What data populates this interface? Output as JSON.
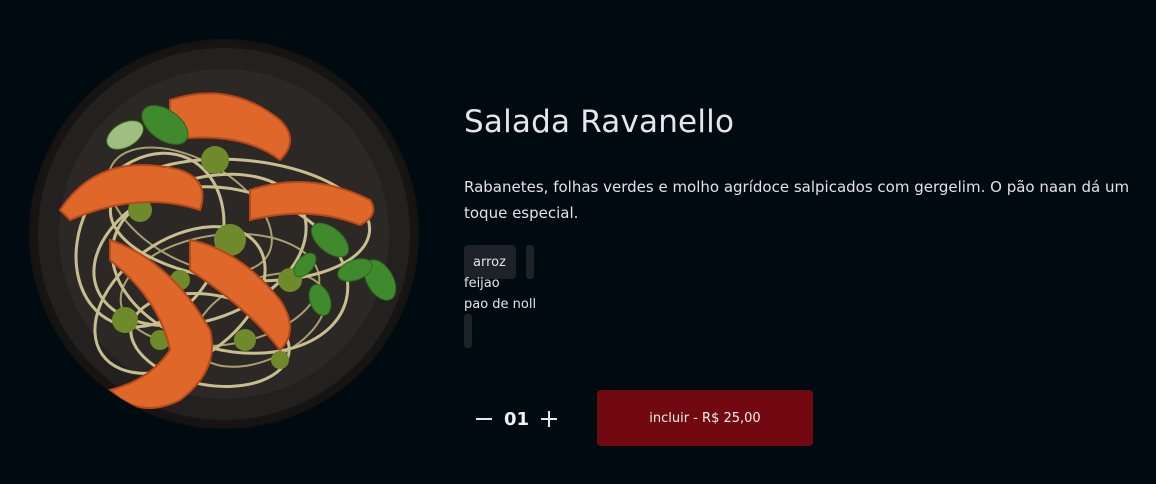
{
  "product": {
    "name": "Salada Ravanello",
    "description": "Rabanetes, folhas verdes e molho agrídoce salpicados com gergelim. O pão naan dá um toque especial.",
    "image_icon": "dish-photo-shrimp-pasta"
  },
  "tags": [
    "arroz",
    "feijao",
    "pao de noll"
  ],
  "quantity": {
    "value": "01",
    "minus_icon": "minus-icon",
    "plus_icon": "plus-icon"
  },
  "add_button": {
    "label": "incluir - R$ 25,00"
  },
  "colors": {
    "background": "#000a11",
    "accent": "#730910",
    "chip": "#1c2227",
    "text": "#e2e2e4"
  }
}
